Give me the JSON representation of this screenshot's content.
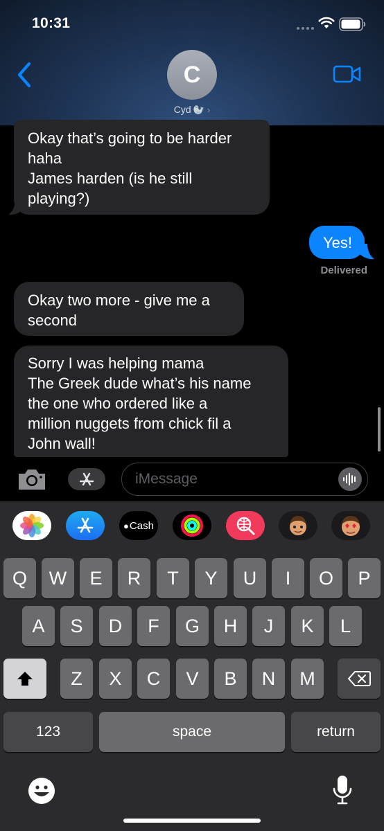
{
  "status_bar": {
    "time": "10:31"
  },
  "header": {
    "avatar_initial": "C",
    "contact_name": "Cyd",
    "contact_emoji": "🦭",
    "chevron": "›",
    "back_icon": "chevron-left-icon",
    "video_icon": "video-camera-icon"
  },
  "messages": [
    {
      "direction": "incoming",
      "lines": [
        "Okay that’s going to be harder",
        "haha",
        "James harden (is he still",
        "playing?)"
      ]
    },
    {
      "direction": "outgoing",
      "lines": [
        "Yes!"
      ],
      "status": "Delivered"
    },
    {
      "direction": "incoming",
      "lines": [
        "Okay two more - give me a",
        "second"
      ]
    },
    {
      "direction": "incoming",
      "lines": [
        "Sorry I was helping mama",
        "The Greek dude what’s his name",
        "the one who ordered like a",
        "million nuggets from chick fil a",
        "John wall!"
      ]
    }
  ],
  "input_bar": {
    "placeholder": "iMessage",
    "camera_icon": "camera-icon",
    "apps_icon": "app-store-icon",
    "audio_icon": "waveform-icon"
  },
  "app_strip": {
    "items": [
      {
        "name": "Photos",
        "icon": "photos-icon"
      },
      {
        "name": "App Store",
        "icon": "app-store-icon"
      },
      {
        "name": "Apple Cash",
        "label": "Cash",
        "icon": "apple-cash-icon"
      },
      {
        "name": "Activity",
        "icon": "activity-rings-icon"
      },
      {
        "name": "Images Search",
        "icon": "globe-search-icon"
      },
      {
        "name": "Memoji",
        "icon": "memoji-icon"
      },
      {
        "name": "Memoji Stickers",
        "icon": "memoji-stickers-icon"
      }
    ]
  },
  "keyboard": {
    "row1": [
      "Q",
      "W",
      "E",
      "R",
      "T",
      "Y",
      "U",
      "I",
      "O",
      "P"
    ],
    "row2": [
      "A",
      "S",
      "D",
      "F",
      "G",
      "H",
      "J",
      "K",
      "L"
    ],
    "row3": [
      "Z",
      "X",
      "C",
      "V",
      "B",
      "N",
      "M"
    ],
    "numbers_label": "123",
    "space_label": "space",
    "return_label": "return",
    "shift_icon": "shift-icon",
    "delete_icon": "delete-icon",
    "emoji_icon": "emoji-icon",
    "mic_icon": "microphone-icon"
  },
  "colors": {
    "outgoing_bubble": "#0b84fe",
    "incoming_bubble": "#262629",
    "accent": "#0a84ff",
    "keyboard_bg": "#2b2b2d"
  }
}
